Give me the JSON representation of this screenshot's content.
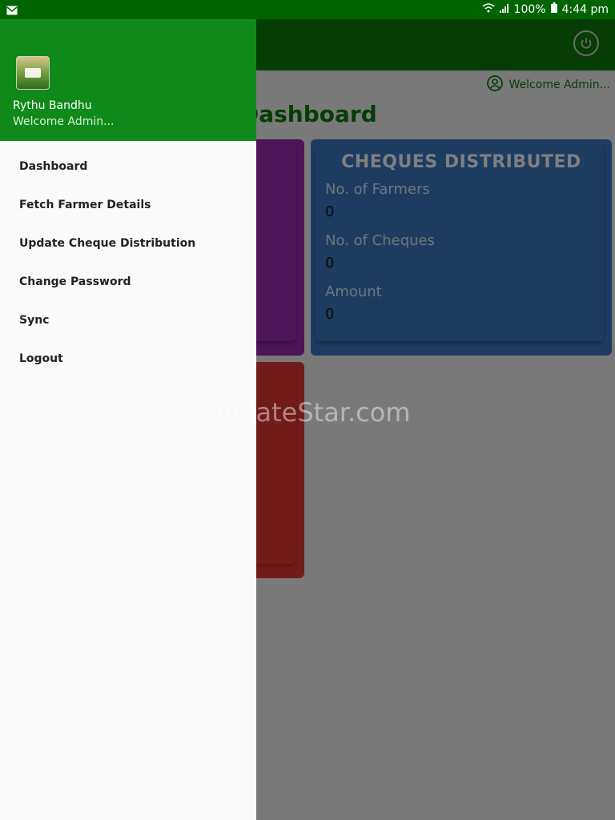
{
  "status_bar": {
    "battery": "100%",
    "time": "4:44 pm"
  },
  "app": {
    "welcome": "Welcome Admin...",
    "dashboard_title": "Dashboard",
    "cheques_card": {
      "title": "CHEQUES DISTRIBUTED",
      "stats": [
        {
          "label": "No. of Farmers",
          "value": "0"
        },
        {
          "label": "No. of Cheques",
          "value": "0"
        },
        {
          "label": "Amount",
          "value": "0"
        }
      ]
    }
  },
  "drawer": {
    "app_name": "Rythu Bandhu",
    "subtitle": "Welcome Admin...",
    "items": [
      {
        "label": "Dashboard"
      },
      {
        "label": "Fetch Farmer Details"
      },
      {
        "label": "Update Cheque Distribution"
      },
      {
        "label": "Change Password"
      },
      {
        "label": "Sync"
      },
      {
        "label": "Logout"
      }
    ]
  },
  "watermark": "UpdateStar.com",
  "colors": {
    "primary": "#0a7a0a",
    "drawer_header": "#0f8a1a",
    "card_blue": "#3a78c2",
    "card_purple": "#9c27b0",
    "card_red": "#e53935"
  },
  "icons": [
    "mail-icon",
    "wifi-icon",
    "signal-icon",
    "battery-icon",
    "power-icon",
    "user-circle-icon",
    "app-logo"
  ]
}
